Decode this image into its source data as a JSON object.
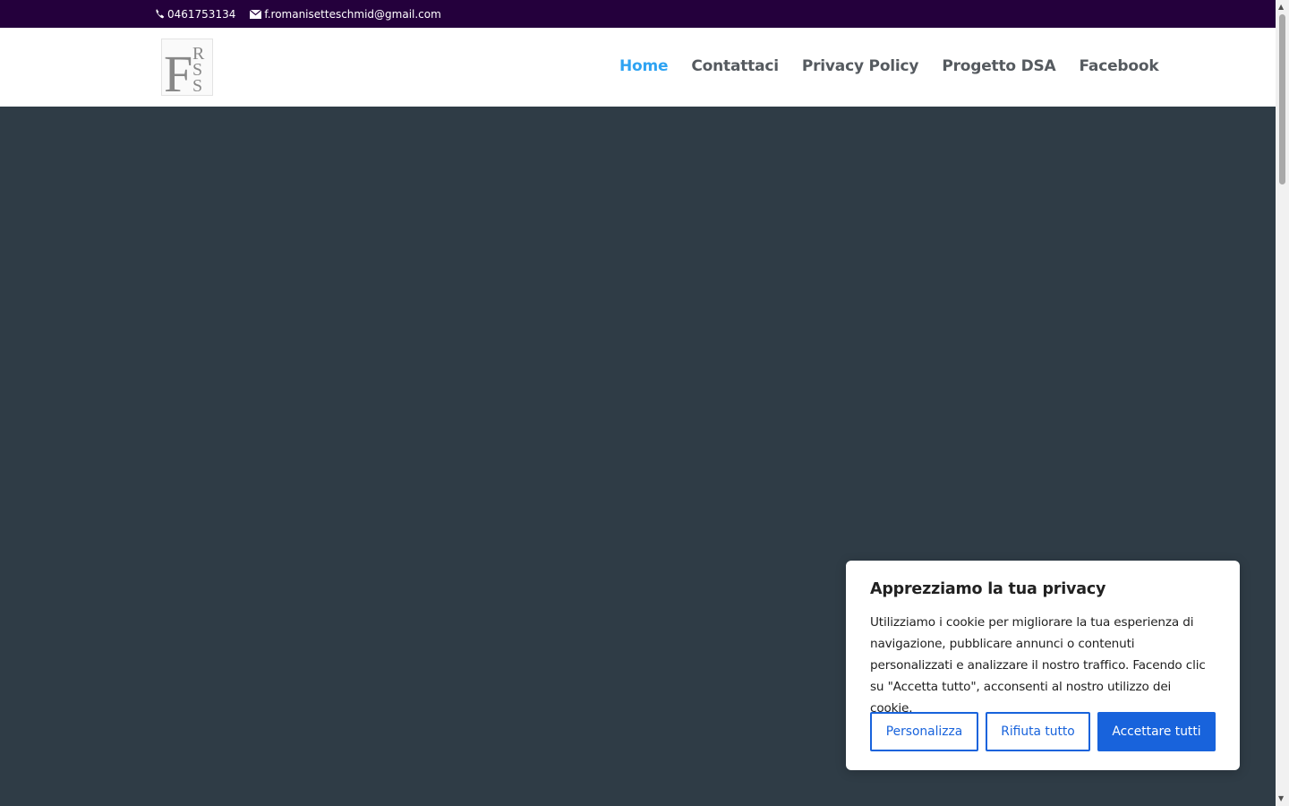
{
  "topbar": {
    "phone": "0461753134",
    "email": "f.romanisetteschmid@gmail.com",
    "phone_icon": "phone-icon",
    "email_icon": "mail-icon"
  },
  "header": {
    "logo_letters": [
      "F",
      "R",
      "S",
      "S"
    ],
    "nav": [
      {
        "label": "Home",
        "active": true
      },
      {
        "label": "Contattaci",
        "active": false
      },
      {
        "label": "Privacy Policy",
        "active": false
      },
      {
        "label": "Progetto DSA",
        "active": false
      },
      {
        "label": "Facebook",
        "active": false
      }
    ]
  },
  "cookie_banner": {
    "title": "Apprezziamo la tua privacy",
    "text": "Utilizziamo i cookie per migliorare la tua esperienza di navigazione, pubblicare annunci o contenuti personalizzati e analizzare il nostro traffico. Facendo clic su \"Accetta tutto\", acconsenti al nostro utilizzo dei cookie.",
    "customize_label": "Personalizza",
    "reject_label": "Rifiuta tutto",
    "accept_label": "Accettare tutti"
  },
  "colors": {
    "topbar_bg": "#24003c",
    "hero_bg": "#2f3c46",
    "nav_active": "#2ea3f2",
    "nav_text": "#555a5f",
    "button_primary": "#1863dc"
  }
}
